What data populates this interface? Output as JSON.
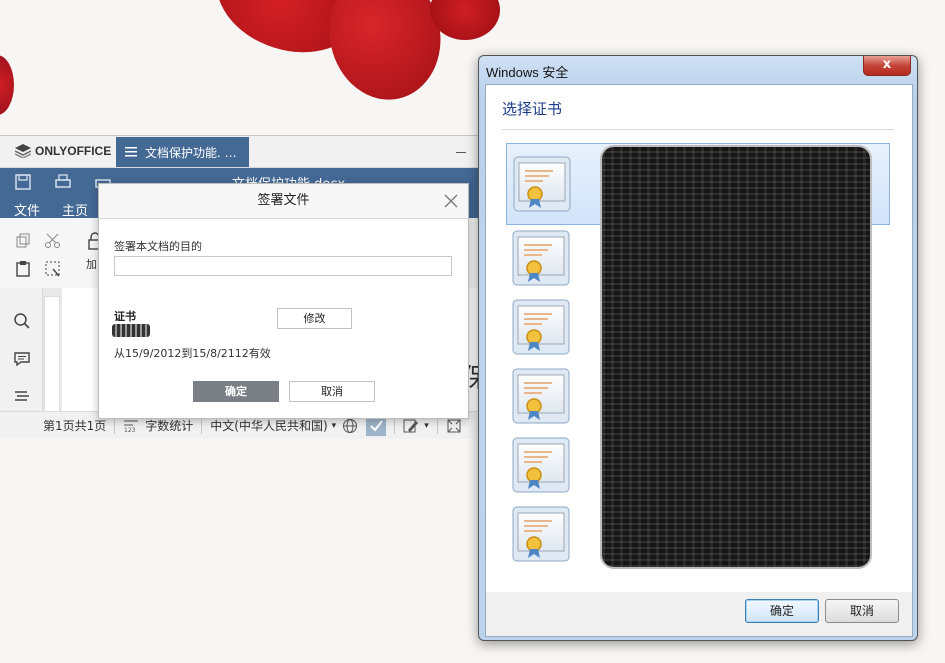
{
  "onlyoffice": {
    "app_name": "ONLYOFFICE",
    "tab_title": "文档保护功能. …",
    "doc_title": "文档保护功能.docx",
    "menu": [
      "文件",
      "主页"
    ],
    "ribbon_partial_label": "加",
    "statusbar": {
      "page_info": "第1页共1页",
      "word_count": "字数统计",
      "language": "中文(中华人民共和国)"
    },
    "doc_glyph": "保"
  },
  "sign_dialog": {
    "title": "签署文件",
    "purpose_label": "签署本文档的目的",
    "purpose_value": "",
    "certificate_label": "证书",
    "validity": "从15/9/2012到15/8/2112有效",
    "edit_button": "修改",
    "ok_button": "确定",
    "cancel_button": "取消"
  },
  "windows_security": {
    "window_title": "Windows 安全",
    "heading": "选择证书",
    "close_glyph": "x",
    "certificate_count": 6,
    "ok_button": "确定",
    "cancel_button": "取消"
  },
  "colors": {
    "onlyoffice_header": "#446995",
    "petal_red": "#c4161c",
    "win_heading": "#1e3e8c"
  }
}
